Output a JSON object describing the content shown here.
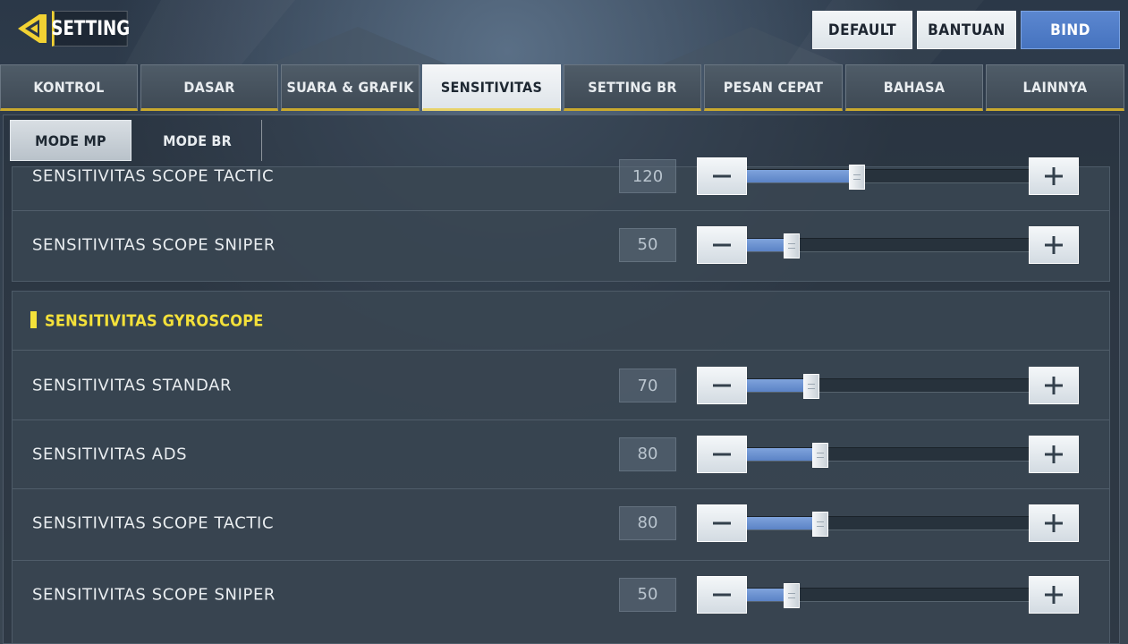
{
  "header": {
    "title": "SETTING",
    "buttons": {
      "default": "DEFAULT",
      "bantuan": "BANTUAN",
      "bind": "BIND"
    }
  },
  "tabs": [
    {
      "label": "KONTROL",
      "active": false
    },
    {
      "label": "DASAR",
      "active": false
    },
    {
      "label": "SUARA & GRAFIK",
      "active": false
    },
    {
      "label": "SENSITIVITAS",
      "active": true
    },
    {
      "label": "SETTING BR",
      "active": false
    },
    {
      "label": "PESAN CEPAT",
      "active": false
    },
    {
      "label": "BAHASA",
      "active": false
    },
    {
      "label": "LAINNYA",
      "active": false
    }
  ],
  "subtabs": {
    "mp": "MODE MP",
    "br": "MODE BR",
    "active": "mp"
  },
  "scroll_section": {
    "rows": [
      {
        "label": "SENSITIVITAS SCOPE TACTIC",
        "value": "120",
        "fill_fraction": 0.39
      },
      {
        "label": "SENSITIVITAS SCOPE SNIPER",
        "value": "50",
        "fill_fraction": 0.16
      }
    ]
  },
  "gyro_section": {
    "title": "SENSITIVITAS GYROSCOPE",
    "rows": [
      {
        "label": "SENSITIVITAS STANDAR",
        "value": "70",
        "fill_fraction": 0.23
      },
      {
        "label": "SENSITIVITAS ADS",
        "value": "80",
        "fill_fraction": 0.26
      },
      {
        "label": "SENSITIVITAS SCOPE TACTIC",
        "value": "80",
        "fill_fraction": 0.26
      },
      {
        "label": "SENSITIVITAS SCOPE SNIPER",
        "value": "50",
        "fill_fraction": 0.16
      }
    ]
  },
  "colors": {
    "accent_yellow": "#f4e13a",
    "slider_fill": "#6a8fd0",
    "bind_button": "#4f7bc6"
  },
  "icons": {
    "back": "back-arrow-icon",
    "minus": "minus-icon",
    "plus": "plus-icon"
  }
}
